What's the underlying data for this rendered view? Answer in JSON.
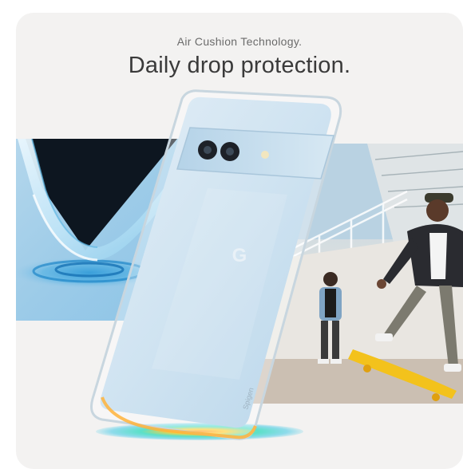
{
  "header": {
    "subtitle": "Air Cushion Technology.",
    "title": "Daily drop protection."
  },
  "product": {
    "brand_mark": "G",
    "case_text": "Spigen"
  },
  "colors": {
    "background": "#f3f2f1",
    "corner_panel": "#9ccbe8",
    "phone_body": "#cfe3f1",
    "impact_glow": "#ff9a2b"
  }
}
